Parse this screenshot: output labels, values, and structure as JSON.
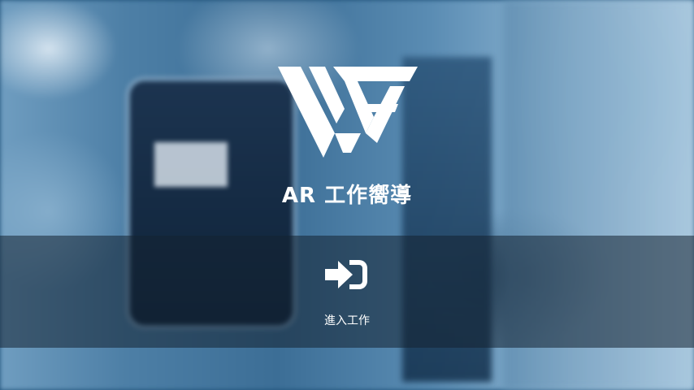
{
  "app": {
    "title": "AR 工作嚮導",
    "logo_icon": "wg-logo-icon",
    "background": "blurred-factory-machine-photo"
  },
  "action": {
    "enter_label": "進入工作",
    "enter_icon": "sign-in-icon"
  },
  "colors": {
    "text": "#ffffff",
    "bar_overlay": "rgba(20,35,50,0.55)",
    "bg_tint": "#3c6e96"
  }
}
